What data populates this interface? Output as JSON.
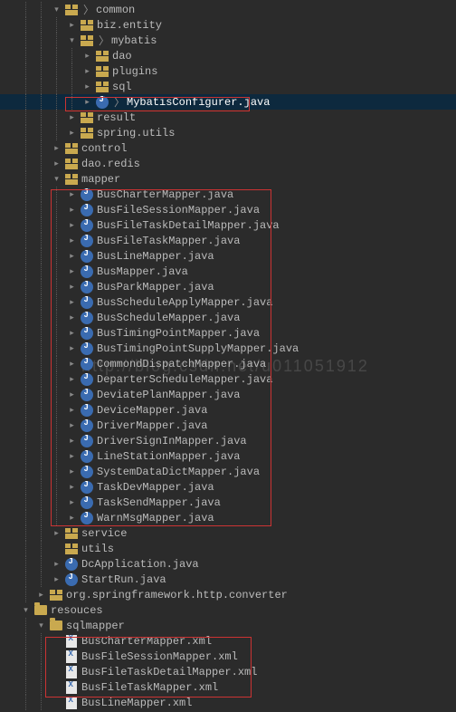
{
  "watermark": "http://blog.csdn.net/u011051912",
  "tree": [
    {
      "depth": 2,
      "arrow": "down",
      "icon": "pkg",
      "breadcrumb": [
        "common"
      ],
      "interact": true
    },
    {
      "depth": 3,
      "arrow": "right",
      "icon": "pkg",
      "text": "biz.entity",
      "interact": true
    },
    {
      "depth": 3,
      "arrow": "down",
      "icon": "pkg",
      "breadcrumb": [
        "mybatis"
      ],
      "interact": true
    },
    {
      "depth": 4,
      "arrow": "right",
      "icon": "pkg",
      "text": "dao",
      "interact": true
    },
    {
      "depth": 4,
      "arrow": "right",
      "icon": "pkg",
      "text": "plugins",
      "interact": true
    },
    {
      "depth": 4,
      "arrow": "right",
      "icon": "pkg",
      "text": "sql",
      "interact": true
    },
    {
      "depth": 4,
      "arrow": "right",
      "icon": "jcls",
      "breadcrumb": [
        "MybatisConfigurer.java"
      ],
      "hl": true,
      "interact": true
    },
    {
      "depth": 3,
      "arrow": "right",
      "icon": "pkg",
      "text": "result",
      "interact": true
    },
    {
      "depth": 3,
      "arrow": "right",
      "icon": "pkg",
      "text": "spring.utils",
      "interact": true
    },
    {
      "depth": 2,
      "arrow": "right",
      "icon": "pkg",
      "text": "control",
      "interact": true
    },
    {
      "depth": 2,
      "arrow": "right",
      "icon": "pkg",
      "text": "dao.redis",
      "interact": true
    },
    {
      "depth": 2,
      "arrow": "down",
      "icon": "pkg",
      "text": "mapper",
      "interact": true
    },
    {
      "depth": 3,
      "arrow": "right",
      "icon": "jcls",
      "text": "BusCharterMapper.java",
      "interact": true
    },
    {
      "depth": 3,
      "arrow": "right",
      "icon": "jcls",
      "text": "BusFileSessionMapper.java",
      "interact": true
    },
    {
      "depth": 3,
      "arrow": "right",
      "icon": "jcls",
      "text": "BusFileTaskDetailMapper.java",
      "interact": true
    },
    {
      "depth": 3,
      "arrow": "right",
      "icon": "jcls",
      "text": "BusFileTaskMapper.java",
      "interact": true
    },
    {
      "depth": 3,
      "arrow": "right",
      "icon": "jcls",
      "text": "BusLineMapper.java",
      "interact": true
    },
    {
      "depth": 3,
      "arrow": "right",
      "icon": "jcls",
      "text": "BusMapper.java",
      "interact": true
    },
    {
      "depth": 3,
      "arrow": "right",
      "icon": "jcls",
      "text": "BusParkMapper.java",
      "interact": true
    },
    {
      "depth": 3,
      "arrow": "right",
      "icon": "jcls",
      "text": "BusScheduleApplyMapper.java",
      "interact": true
    },
    {
      "depth": 3,
      "arrow": "right",
      "icon": "jcls",
      "text": "BusScheduleMapper.java",
      "interact": true
    },
    {
      "depth": 3,
      "arrow": "right",
      "icon": "jcls",
      "text": "BusTimingPointMapper.java",
      "interact": true
    },
    {
      "depth": 3,
      "arrow": "right",
      "icon": "jcls",
      "text": "BusTimingPointSupplyMapper.java",
      "interact": true
    },
    {
      "depth": 3,
      "arrow": "right",
      "icon": "jcls",
      "text": "CommondDispatchMapper.java",
      "interact": true
    },
    {
      "depth": 3,
      "arrow": "right",
      "icon": "jcls",
      "text": "DeparterScheduleMapper.java",
      "interact": true
    },
    {
      "depth": 3,
      "arrow": "right",
      "icon": "jcls",
      "text": "DeviatePlanMapper.java",
      "interact": true
    },
    {
      "depth": 3,
      "arrow": "right",
      "icon": "jcls",
      "text": "DeviceMapper.java",
      "interact": true
    },
    {
      "depth": 3,
      "arrow": "right",
      "icon": "jcls",
      "text": "DriverMapper.java",
      "interact": true
    },
    {
      "depth": 3,
      "arrow": "right",
      "icon": "jcls",
      "text": "DriverSignInMapper.java",
      "interact": true
    },
    {
      "depth": 3,
      "arrow": "right",
      "icon": "jcls",
      "text": "LineStationMapper.java",
      "interact": true
    },
    {
      "depth": 3,
      "arrow": "right",
      "icon": "jcls",
      "text": "SystemDataDictMapper.java",
      "interact": true
    },
    {
      "depth": 3,
      "arrow": "right",
      "icon": "jcls",
      "text": "TaskDevMapper.java",
      "interact": true
    },
    {
      "depth": 3,
      "arrow": "right",
      "icon": "jcls",
      "text": "TaskSendMapper.java",
      "interact": true
    },
    {
      "depth": 3,
      "arrow": "right",
      "icon": "jcls",
      "text": "WarnMsgMapper.java",
      "interact": true
    },
    {
      "depth": 2,
      "arrow": "right",
      "icon": "pkg",
      "text": "service",
      "interact": true
    },
    {
      "depth": 2,
      "arrow": "none",
      "icon": "pkg",
      "text": "utils",
      "interact": true
    },
    {
      "depth": 2,
      "arrow": "right",
      "icon": "jcls",
      "text": "DcApplication.java",
      "interact": true
    },
    {
      "depth": 2,
      "arrow": "right",
      "icon": "jcls",
      "text": "StartRun.java",
      "interact": true
    },
    {
      "depth": 1,
      "arrow": "right",
      "icon": "pkg",
      "text": "org.springframework.http.converter",
      "interact": true
    },
    {
      "depth": 0,
      "arrow": "down",
      "icon": "folder",
      "text": "resouces",
      "interact": true
    },
    {
      "depth": 1,
      "arrow": "down",
      "icon": "folder",
      "text": "sqlmapper",
      "interact": true
    },
    {
      "depth": 2,
      "arrow": "none",
      "icon": "xml",
      "text": "BusCharterMapper.xml",
      "interact": true
    },
    {
      "depth": 2,
      "arrow": "none",
      "icon": "xml",
      "text": "BusFileSessionMapper.xml",
      "interact": true
    },
    {
      "depth": 2,
      "arrow": "none",
      "icon": "xml",
      "text": "BusFileTaskDetailMapper.xml",
      "interact": true
    },
    {
      "depth": 2,
      "arrow": "none",
      "icon": "xml",
      "text": "BusFileTaskMapper.xml",
      "interact": true
    },
    {
      "depth": 2,
      "arrow": "none",
      "icon": "xml",
      "text": "BusLineMapper.xml",
      "interact": true
    }
  ]
}
